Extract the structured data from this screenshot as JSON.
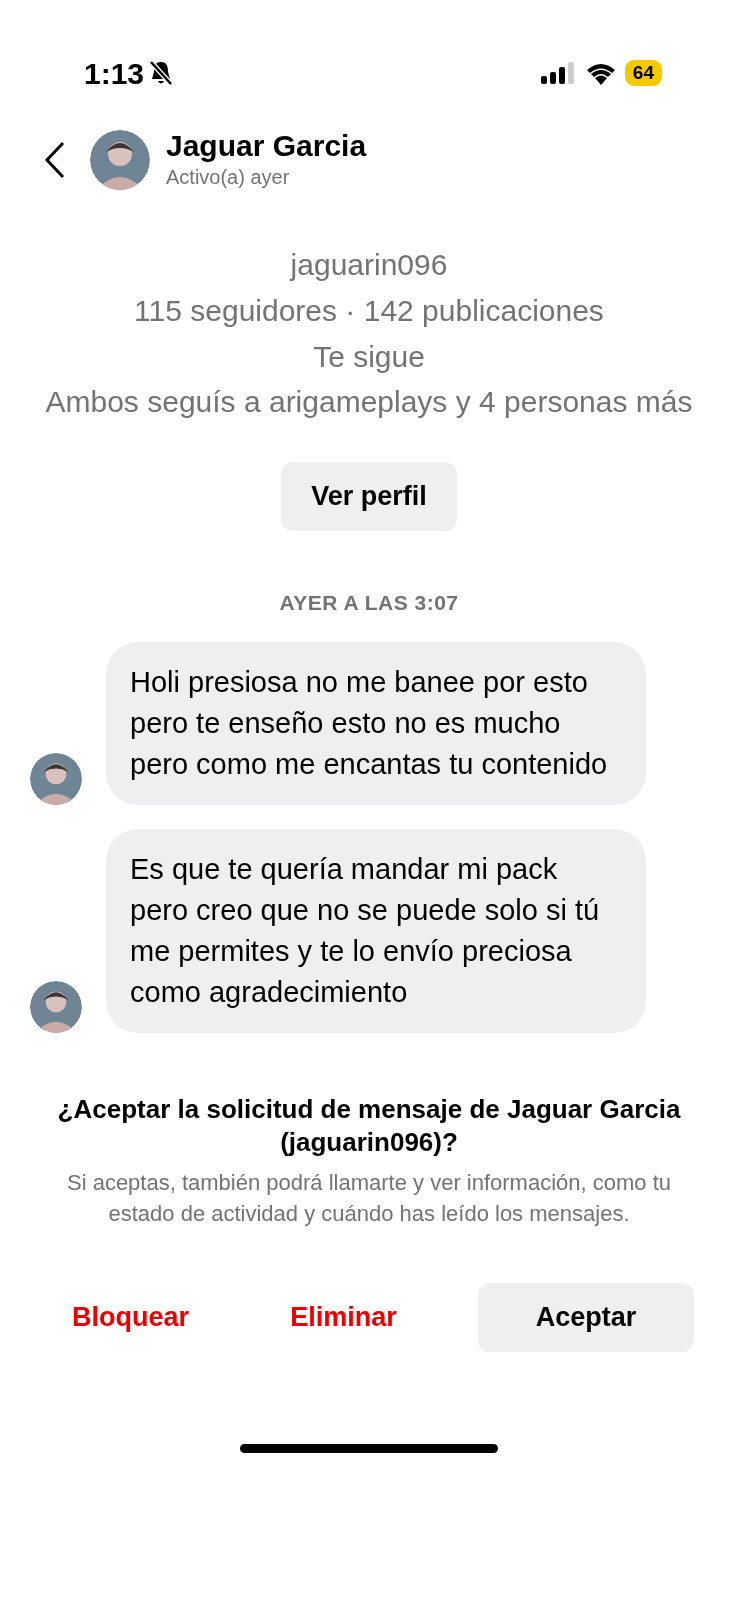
{
  "status_bar": {
    "time": "1:13",
    "silent": true,
    "battery": "64"
  },
  "header": {
    "name": "Jaguar Garcia",
    "activity": "Activo(a) ayer"
  },
  "profile": {
    "username": "jaguarin096",
    "stats": "115 seguidores · 142 publicaciones",
    "follow_status": "Te sigue",
    "mutual": "Ambos seguís a arigameplays y 4 personas más",
    "view_profile": "Ver perfil"
  },
  "timestamp": "AYER A LAS 3:07",
  "messages": [
    {
      "text": "Holi presiosa no me banee por esto pero te enseño esto no es mucho pero como me encantas tu contenido"
    },
    {
      "text": "Es que te quería mandar mi pack pero creo que no se puede solo si tú me permites y te lo envío preciosa como agradecimiento"
    }
  ],
  "request": {
    "title": "¿Aceptar la solicitud de mensaje de Jaguar Garcia (jaguarin096)?",
    "description": "Si aceptas, también podrá llamarte y ver información, como tu estado de actividad y cuándo has leído los mensajes.",
    "actions": [
      {
        "label": "Bloquear",
        "kind": "danger"
      },
      {
        "label": "Eliminar",
        "kind": "danger"
      },
      {
        "label": "Aceptar",
        "kind": "primary"
      }
    ]
  }
}
